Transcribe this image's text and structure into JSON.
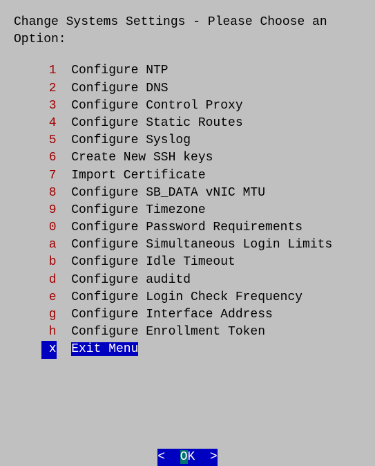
{
  "header": "Change Systems Settings - Please Choose an Option:",
  "menu": {
    "items": [
      {
        "key": "1",
        "label": "Configure NTP",
        "selected": false
      },
      {
        "key": "2",
        "label": "Configure DNS",
        "selected": false
      },
      {
        "key": "3",
        "label": "Configure Control Proxy",
        "selected": false
      },
      {
        "key": "4",
        "label": "Configure Static Routes",
        "selected": false
      },
      {
        "key": "5",
        "label": "Configure Syslog",
        "selected": false
      },
      {
        "key": "6",
        "label": "Create New SSH keys",
        "selected": false
      },
      {
        "key": "7",
        "label": "Import Certificate",
        "selected": false
      },
      {
        "key": "8",
        "label": "Configure SB_DATA vNIC MTU",
        "selected": false
      },
      {
        "key": "9",
        "label": "Configure Timezone",
        "selected": false
      },
      {
        "key": "0",
        "label": "Configure Password Requirements",
        "selected": false
      },
      {
        "key": "a",
        "label": "Configure Simultaneous Login Limits",
        "selected": false
      },
      {
        "key": "b",
        "label": "Configure Idle Timeout",
        "selected": false
      },
      {
        "key": "d",
        "label": "Configure auditd",
        "selected": false
      },
      {
        "key": "e",
        "label": "Configure Login Check Frequency",
        "selected": false
      },
      {
        "key": "g",
        "label": "Configure Interface Address",
        "selected": false
      },
      {
        "key": "h",
        "label": "Configure Enrollment Token",
        "selected": false
      },
      {
        "key": "x",
        "label": "Exit Menu",
        "selected": true
      }
    ]
  },
  "ok_button": {
    "left": "<  ",
    "hotkey": "O",
    "rest": "K  >"
  }
}
